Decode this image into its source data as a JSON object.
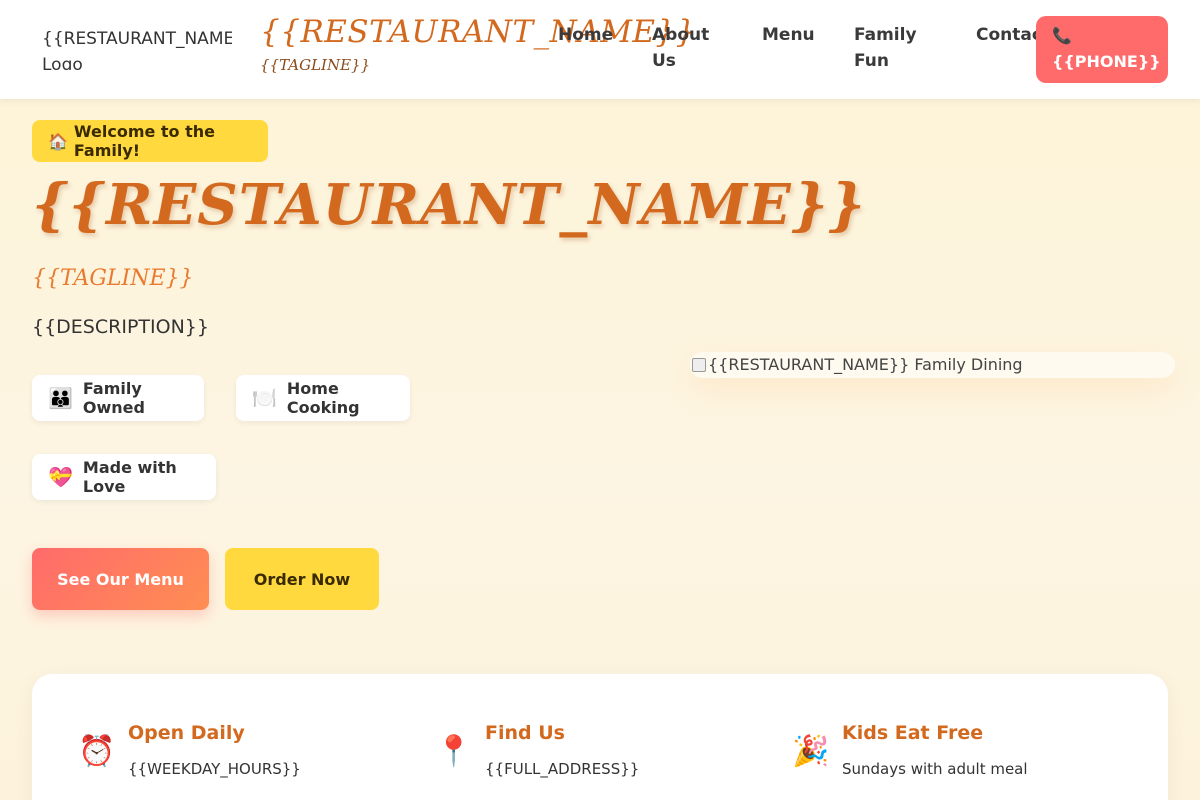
{
  "header": {
    "logo_alt": "{{RESTAURANT_NAME}} Logo",
    "brand_name": "{{RESTAURANT_NAME}}",
    "brand_tagline": "{{TAGLINE}}",
    "nav": [
      {
        "label": "Home"
      },
      {
        "label": "About Us"
      },
      {
        "label": "Menu"
      },
      {
        "label": "Family Fun"
      },
      {
        "label": "Contact"
      }
    ],
    "phone_icon": "📞",
    "phone_label": "{{PHONE}}"
  },
  "hero": {
    "welcome_icon": "🏠",
    "welcome_label": "Welcome to the Family!",
    "title": "{{RESTAURANT_NAME}}",
    "tagline": "{{TAGLINE}}",
    "description": "{{DESCRIPTION}}",
    "features": [
      {
        "icon": "👪",
        "icon_name": "family-icon",
        "label": "Family Owned"
      },
      {
        "icon": "🍽️",
        "icon_name": "plate-icon",
        "label": "Home Cooking"
      },
      {
        "icon": "💝",
        "icon_name": "heart-icon",
        "label": "Made with Love"
      }
    ],
    "primary_button": "See Our Menu",
    "secondary_button": "Order Now",
    "image_alt": "{{RESTAURANT_NAME}} Family Dining"
  },
  "info": [
    {
      "icon": "⏰",
      "icon_name": "alarm-clock-icon",
      "title": "Open Daily",
      "text": "{{WEEKDAY_HOURS}}"
    },
    {
      "icon": "📍",
      "icon_name": "location-pin-icon",
      "title": "Find Us",
      "text": "{{FULL_ADDRESS}}"
    },
    {
      "icon": "🎉",
      "icon_name": "party-popper-icon",
      "title": "Kids Eat Free",
      "text": "Sundays with adult meal"
    }
  ],
  "colors": {
    "accent_orange": "#d2691e",
    "coral": "#ff6b6b",
    "yellow": "#ffd93d"
  }
}
